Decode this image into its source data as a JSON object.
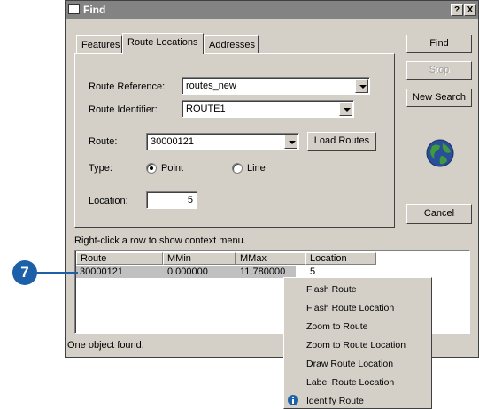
{
  "window": {
    "title": "Find",
    "help_btn": "?",
    "close_btn": "X"
  },
  "tabs": [
    {
      "label": "Features",
      "active": false
    },
    {
      "label": "Route Locations",
      "active": true
    },
    {
      "label": "Addresses",
      "active": false
    }
  ],
  "form": {
    "route_reference_label": "Route Reference:",
    "route_reference_value": "routes_new",
    "route_identifier_label": "Route Identifier:",
    "route_identifier_value": "ROUTE1",
    "route_label": "Route:",
    "route_value": "30000121",
    "load_routes": "Load Routes",
    "type_label": "Type:",
    "type_point": "Point",
    "type_line": "Line",
    "selected_type": "Point",
    "location_label": "Location:",
    "location_value": "5"
  },
  "side_buttons": {
    "find": "Find",
    "stop": "Stop",
    "new_search": "New Search",
    "cancel": "Cancel"
  },
  "hint": "Right-click a row to show context menu.",
  "results": {
    "columns": [
      "Route",
      "MMin",
      "MMax",
      "Location"
    ],
    "rows": [
      {
        "route": "30000121",
        "mmin": "0.000000",
        "mmax": "11.780000",
        "location": "5"
      }
    ]
  },
  "status": "One object found.",
  "context_menu": [
    "Flash Route",
    "Flash Route Location",
    "Zoom to Route",
    "Zoom to Route Location",
    "Draw Route Location",
    "Label Route Location",
    "Identify Route"
  ],
  "callout": {
    "number": "7"
  },
  "colors": {
    "titlebar": "#838383",
    "dialog": "#d4d0c8",
    "callout": "#1b60a8",
    "selected_row": "#c0c0c0"
  },
  "icons": {
    "globe": "globe-icon",
    "info": "info-icon"
  }
}
